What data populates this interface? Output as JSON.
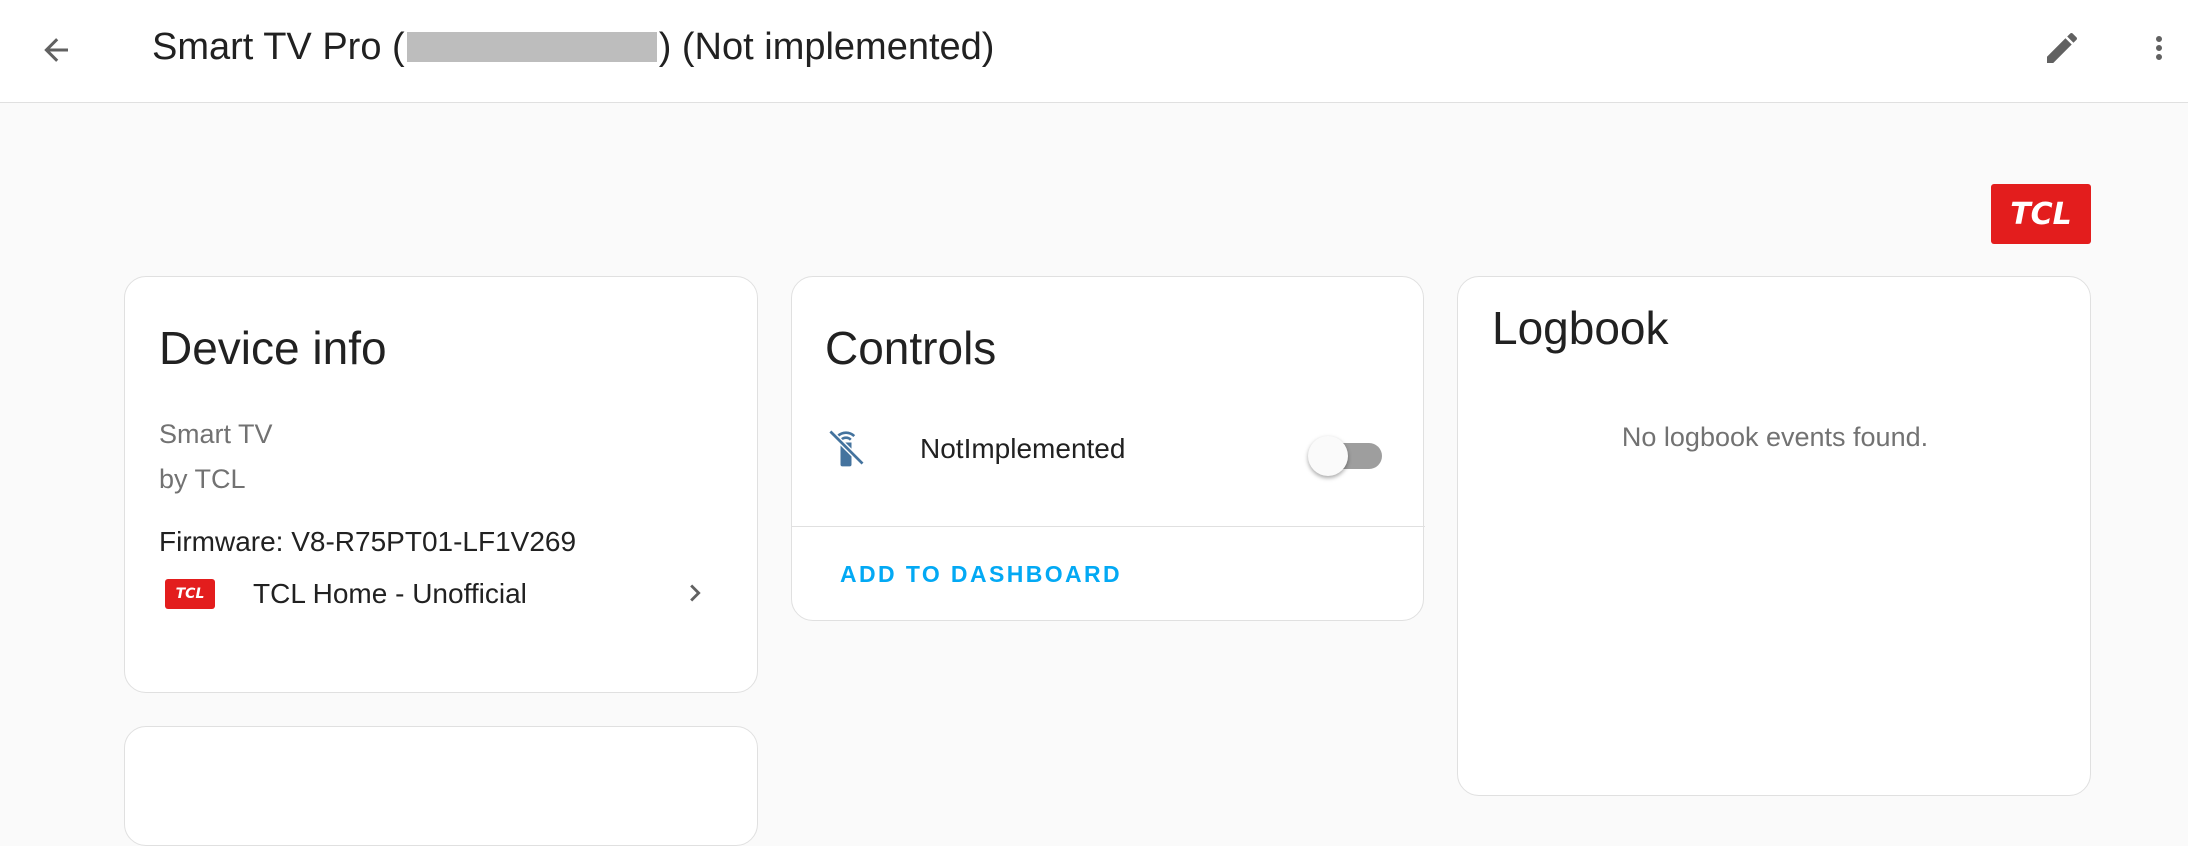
{
  "header": {
    "title_prefix": "Smart TV Pro (",
    "title_suffix": ") (Not implemented)"
  },
  "icons": {
    "back": "arrow-left-icon",
    "edit": "pencil-icon",
    "menu": "dots-vertical-icon",
    "chevron": "chevron-right-icon",
    "entity": "remote-off-icon"
  },
  "brand": {
    "logo_text": "TCL",
    "color": "#e31d1d"
  },
  "device_info": {
    "title": "Device info",
    "model": "Smart TV",
    "manufacturer": "by TCL",
    "firmware": "Firmware: V8-R75PT01-LF1V269",
    "integration": {
      "logo_text": "TCL",
      "name": "TCL Home - Unofficial"
    }
  },
  "controls": {
    "title": "Controls",
    "entity": {
      "name": "NotImplemented",
      "state": "off"
    },
    "add_to_dashboard": "ADD TO DASHBOARD"
  },
  "logbook": {
    "title": "Logbook",
    "empty_message": "No logbook events found."
  },
  "colors": {
    "accent": "#03a9f4",
    "icon": "#44739e"
  }
}
